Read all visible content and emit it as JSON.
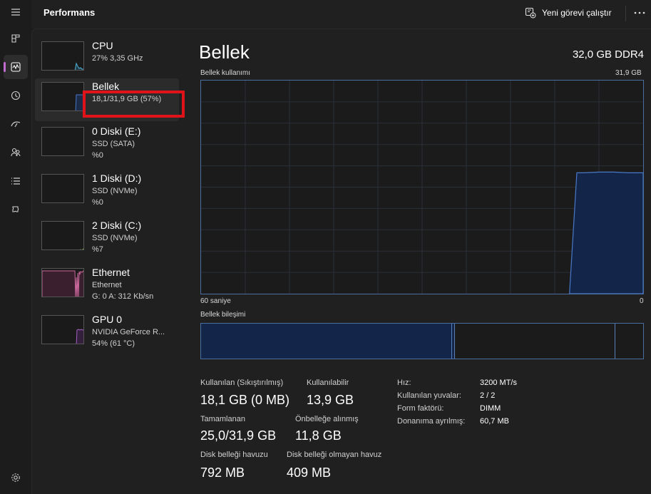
{
  "app": {
    "title": "Performans",
    "new_task_label": "Yeni görevi çalıştır"
  },
  "nav_icons": [
    "hamburger-menu-icon",
    "processes-icon",
    "performance-icon",
    "app-history-icon",
    "startup-apps-icon",
    "users-icon",
    "details-icon",
    "services-icon",
    "settings-icon"
  ],
  "devices": [
    {
      "name": "CPU",
      "line2": "27% 3,35 GHz",
      "line3": "",
      "graph_color": "#4fb3d9"
    },
    {
      "name": "Bellek",
      "line2": "18,1/31,9 GB (57%)",
      "line3": "",
      "graph_color": "#4a78c8"
    },
    {
      "name": "0 Diski (E:)",
      "line2": "SSD (SATA)",
      "line3": "%0",
      "graph_color": "#76b852"
    },
    {
      "name": "1 Diski (D:)",
      "line2": "SSD (NVMe)",
      "line3": "%0",
      "graph_color": "#76b852"
    },
    {
      "name": "2 Diski (C:)",
      "line2": "SSD (NVMe)",
      "line3": "%7",
      "graph_color": "#76b852"
    },
    {
      "name": "Ethernet",
      "line2": "Ethernet",
      "line3": "G: 0 A: 312 Kb/sn",
      "graph_color": "#c9669b"
    },
    {
      "name": "GPU 0",
      "line2": "NVIDIA GeForce R...",
      "line3": "54% (61 °C)",
      "graph_color": "#a35fc4"
    }
  ],
  "detail": {
    "title": "Bellek",
    "spec": "32,0 GB DDR4",
    "usage_label": "Bellek kullanımı",
    "usage_max": "31,9 GB",
    "time_left": "60 saniye",
    "time_right": "0",
    "composition_label": "Bellek bileşimi"
  },
  "chart_data": {
    "type": "area",
    "title": "Bellek kullanımı",
    "xlabel": "60 saniye",
    "ylabel": "",
    "x_range": [
      60,
      0
    ],
    "ylim": [
      0,
      31.9
    ],
    "grid": true,
    "x": [
      60,
      57,
      54,
      51,
      48,
      45,
      42,
      39,
      36,
      33,
      30,
      27,
      24,
      21,
      18,
      15,
      12,
      10,
      9,
      8,
      6,
      4,
      2,
      0
    ],
    "values": [
      null,
      null,
      null,
      null,
      null,
      null,
      null,
      null,
      null,
      null,
      null,
      null,
      null,
      null,
      null,
      null,
      null,
      0,
      18.1,
      18.1,
      18.2,
      18.2,
      18.1,
      18.1
    ],
    "color": "#4a78c8"
  },
  "stats": [
    {
      "label": "Kullanılan (Sıkıştırılmış)",
      "value": "18,1 GB (0 MB)"
    },
    {
      "label": "Kullanılabilir",
      "value": "13,9 GB"
    },
    {
      "label": "Tamamlanan",
      "value": "25,0/31,9 GB"
    },
    {
      "label": "Önbelleğe alınmış",
      "value": "11,8 GB"
    },
    {
      "label": "Disk belleği havuzu",
      "value": "792 MB"
    },
    {
      "label": "Disk belleği olmayan havuz",
      "value": "409 MB"
    }
  ],
  "specs": [
    {
      "key": "Hız:",
      "value": "3200 MT/s"
    },
    {
      "key": "Kullanılan yuvalar:",
      "value": "2 / 2"
    },
    {
      "key": "Form faktörü:",
      "value": "DIMM"
    },
    {
      "key": "Donanıma ayrılmış:",
      "value": "60,7 MB"
    }
  ]
}
